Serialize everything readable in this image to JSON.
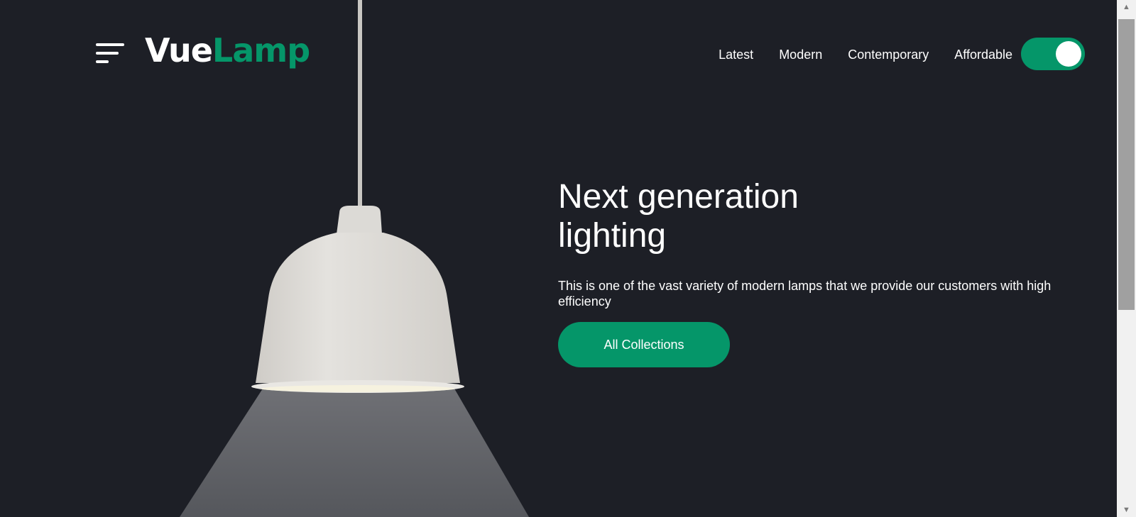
{
  "header": {
    "logo_part1": "Vue",
    "logo_part2": "Lamp",
    "menu_icon": "hamburger-menu-icon",
    "nav": [
      "Latest",
      "Modern",
      "Contemporary",
      "Affordable"
    ],
    "theme_toggle": {
      "on": true
    }
  },
  "hero": {
    "title_line1": "Next generation",
    "title_line2": "lighting",
    "description": "This is one of the vast variety of modern lamps that we provide our customers with high efficiency",
    "cta_label": "All Collections"
  },
  "colors": {
    "background": "#1d1f26",
    "accent": "#059669",
    "text": "#ffffff",
    "lamp_shade": "#d9d7d3"
  }
}
